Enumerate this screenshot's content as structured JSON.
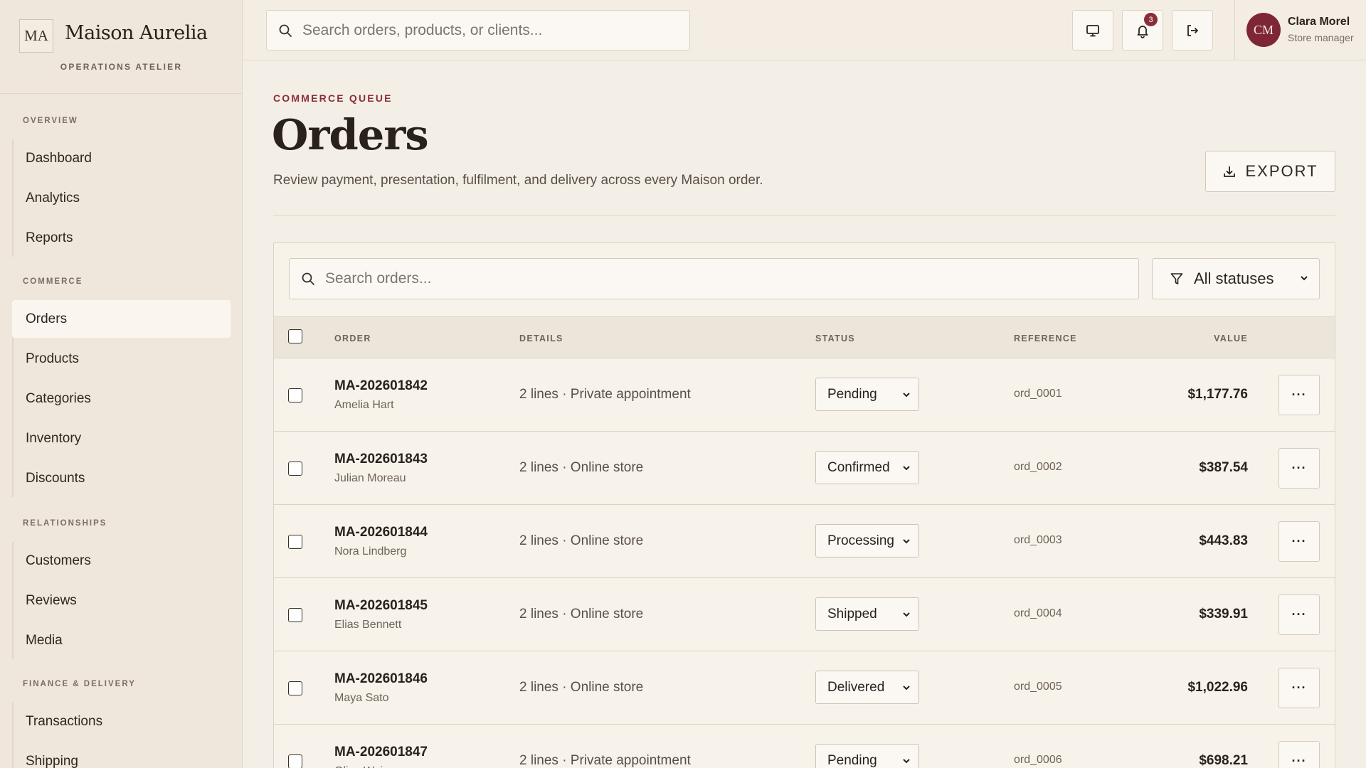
{
  "brand": {
    "mark": "MA",
    "name": "Maison Aurelia",
    "subtitle": "OPERATIONS ATELIER"
  },
  "nav": [
    {
      "heading": "OVERVIEW",
      "items": [
        "Dashboard",
        "Analytics",
        "Reports"
      ]
    },
    {
      "heading": "COMMERCE",
      "items": [
        "Orders",
        "Products",
        "Categories",
        "Inventory",
        "Discounts"
      ],
      "active": "Orders"
    },
    {
      "heading": "RELATIONSHIPS",
      "items": [
        "Customers",
        "Reviews",
        "Media"
      ]
    },
    {
      "heading": "FINANCE & DELIVERY",
      "items": [
        "Transactions",
        "Shipping"
      ]
    }
  ],
  "topbar": {
    "search_placeholder": "Search orders, products, or clients...",
    "notifications_count": "3",
    "icons": [
      "monitor-icon",
      "bell-icon",
      "logout-icon"
    ]
  },
  "user": {
    "initials": "CM",
    "name": "Clara Morel",
    "role": "Store manager"
  },
  "page": {
    "eyebrow": "COMMERCE QUEUE",
    "title": "Orders",
    "description": "Review payment, presentation, fulfilment, and delivery across every Maison order.",
    "export_label": "EXPORT"
  },
  "filters": {
    "search_placeholder": "Search orders...",
    "status_selected": "All statuses"
  },
  "table": {
    "headers": {
      "order": "ORDER",
      "details": "DETAILS",
      "status": "STATUS",
      "reference": "REFERENCE",
      "value": "VALUE"
    },
    "rows": [
      {
        "id": "MA-202601842",
        "client": "Amelia Hart",
        "details": "2 lines · Private appointment",
        "status": "Pending",
        "ref": "ord_0001",
        "value": "$1,177.76"
      },
      {
        "id": "MA-202601843",
        "client": "Julian Moreau",
        "details": "2 lines · Online store",
        "status": "Confirmed",
        "ref": "ord_0002",
        "value": "$387.54"
      },
      {
        "id": "MA-202601844",
        "client": "Nora Lindberg",
        "details": "2 lines · Online store",
        "status": "Processing",
        "ref": "ord_0003",
        "value": "$443.83"
      },
      {
        "id": "MA-202601845",
        "client": "Elias Bennett",
        "details": "2 lines · Online store",
        "status": "Shipped",
        "ref": "ord_0004",
        "value": "$339.91"
      },
      {
        "id": "MA-202601846",
        "client": "Maya Sato",
        "details": "2 lines · Online store",
        "status": "Delivered",
        "ref": "ord_0005",
        "value": "$1,022.96"
      },
      {
        "id": "MA-202601847",
        "client": "Olive Weiss",
        "details": "2 lines · Private appointment",
        "status": "Pending",
        "ref": "ord_0006",
        "value": "$698.21"
      }
    ],
    "more_label": "···"
  },
  "colors": {
    "accent": "#8a2d3b",
    "background": "#f4efe6",
    "sidebar": "#efe7db"
  }
}
